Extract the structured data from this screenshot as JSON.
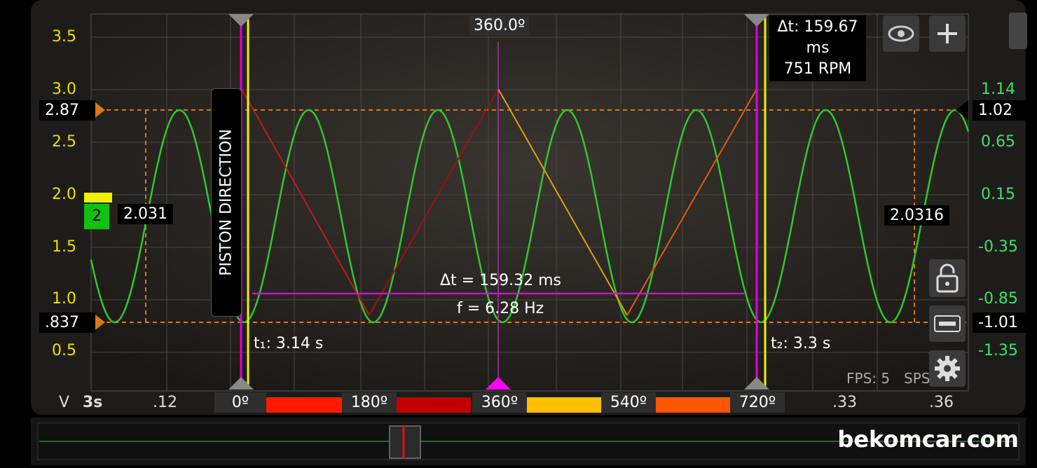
{
  "left_axis": {
    "unit": "V",
    "ticks": [
      "3.5",
      "3.0",
      "2.5",
      "2.0",
      "1.5",
      "1.0",
      "0.5"
    ],
    "color": "#e8e000"
  },
  "right_axis": {
    "ticks": [
      "1.14",
      "0.65",
      "0.15",
      "-0.35",
      "-0.85",
      "-1.35"
    ],
    "color": "#3ee06a"
  },
  "time_axis": {
    "start": "3s",
    "ticks": [
      ".12",
      ".33",
      ".36"
    ]
  },
  "levels": {
    "left_upper": "2.87",
    "left_lower": ".837",
    "right_upper": "1.02",
    "right_lower": "-1.01",
    "channel_badge": "2",
    "left_value": "2.031",
    "right_value": "2.0316"
  },
  "cursors": {
    "top_angle": "360.0º",
    "delta_time": "Δt: 159.67 ms",
    "rpm": "751 RPM",
    "t1": "t₁: 3.14 s",
    "t2": "t₂: 3.3 s",
    "measure_dt": "Δt = 159.32 ms",
    "measure_f": "f = 6.28 Hz",
    "piston_label": "PISTON DIRECTION"
  },
  "degree_bar": {
    "labels": [
      "0º",
      "180º",
      "360º",
      "540º",
      "720º"
    ],
    "colors": [
      "#ff1a00",
      "#c00000",
      "#ffbf00",
      "#ff5500"
    ]
  },
  "status": {
    "fps": "FPS: 5",
    "sps": "SPS"
  },
  "brand": "bekomcar.com",
  "icons": [
    "eye-icon",
    "plus-icon",
    "lock-icon",
    "abc-icon",
    "gear-icon"
  ],
  "colors": {
    "green_trace": "#2ec82e",
    "level_orange": "#d87818",
    "cursor_magenta": "#e000e0",
    "cursor_yellow": "#f0f000"
  }
}
